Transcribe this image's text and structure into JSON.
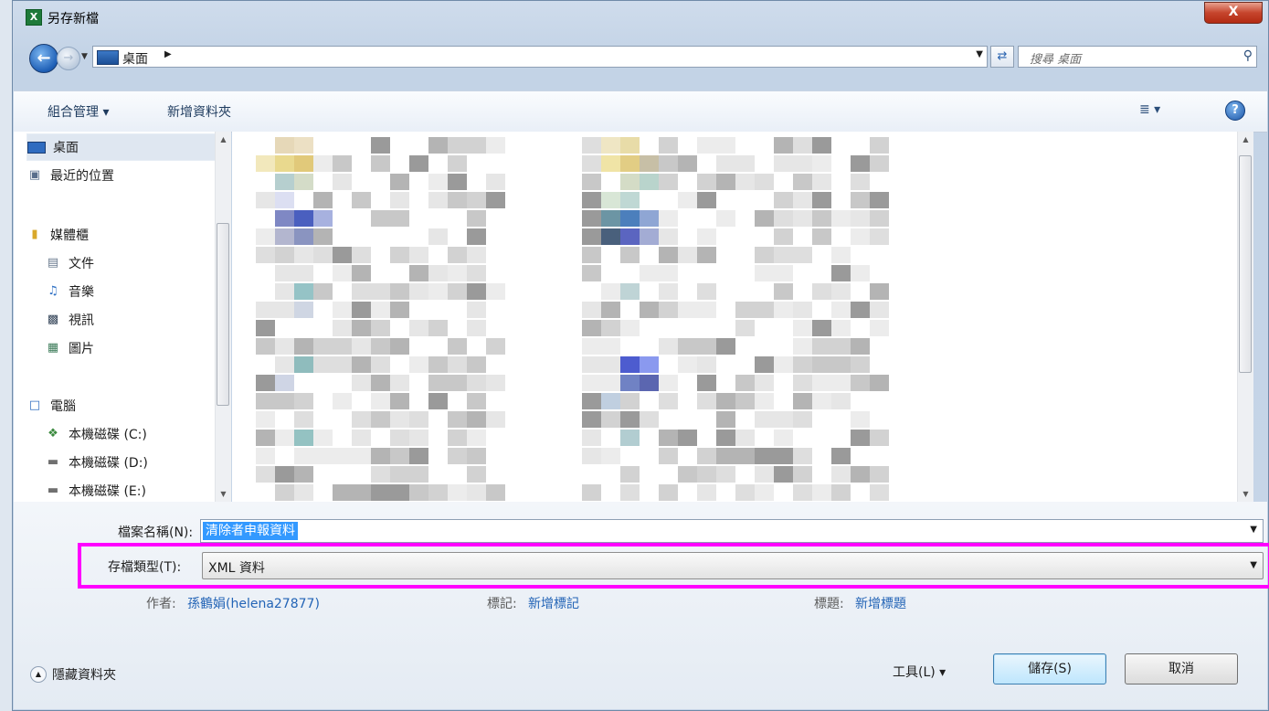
{
  "window": {
    "title": "另存新檔",
    "close_label": "X",
    "app_icon": "excel-icon"
  },
  "nav": {
    "address_location": "桌面",
    "search_placeholder": "搜尋 桌面"
  },
  "toolbar": {
    "organize_label": "組合管理 ▾",
    "new_folder_label": "新增資料夾",
    "view_label": "≣ ▾",
    "help_label": "?"
  },
  "sidebar": {
    "items": [
      {
        "label": "桌面",
        "icon": "desktop-icon"
      },
      {
        "label": "最近的位置",
        "icon": "recent-places-icon"
      },
      {
        "label": "媒體櫃",
        "icon": "library-icon"
      },
      {
        "label": "文件",
        "icon": "document-icon"
      },
      {
        "label": "音樂",
        "icon": "music-icon"
      },
      {
        "label": "視訊",
        "icon": "video-icon"
      },
      {
        "label": "圖片",
        "icon": "picture-icon"
      },
      {
        "label": "電腦",
        "icon": "computer-icon"
      },
      {
        "label": "本機磁碟 (C:)",
        "icon": "drive-c-icon"
      },
      {
        "label": "本機磁碟 (D:)",
        "icon": "drive-icon"
      },
      {
        "label": "本機磁碟 (E:)",
        "icon": "drive-icon"
      }
    ]
  },
  "form": {
    "filename_label": "檔案名稱(N):",
    "filename_value": "清除者申報資料",
    "filetype_label": "存檔類型(T):",
    "filetype_value": "XML 資料"
  },
  "meta": {
    "author_label": "作者:",
    "author_value": "孫鶴娟(helena27877)",
    "tags_label": "標記:",
    "tags_value": "新增標記",
    "title_label": "標題:",
    "title_value": "新增標題"
  },
  "footer": {
    "hide_folders_label": "隱藏資料夾",
    "tools_label": "工具(L)  ▾",
    "save_label": "儲存(S)",
    "cancel_label": "取消"
  }
}
